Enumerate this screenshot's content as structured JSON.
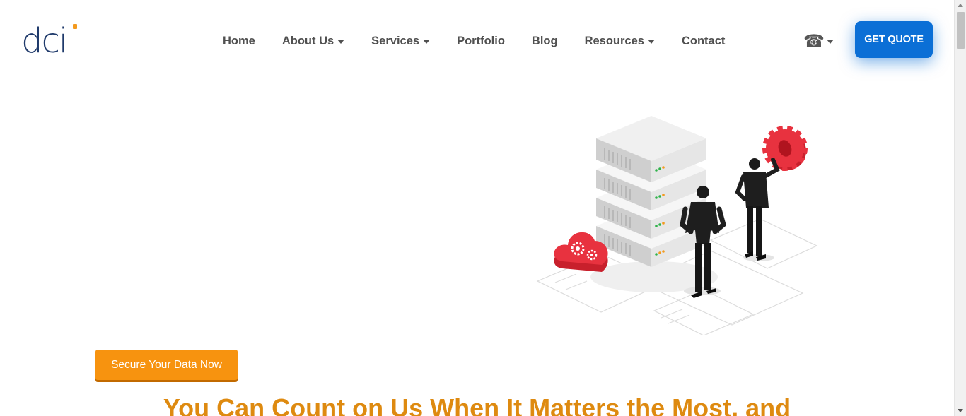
{
  "header": {
    "logo_text": "dci",
    "nav": {
      "home": "Home",
      "about": "About Us",
      "services": "Services",
      "portfolio": "Portfolio",
      "blog": "Blog",
      "resources": "Resources",
      "contact": "Contact"
    },
    "phone_glyph": "☎",
    "quote_button": "GET QUOTE"
  },
  "hero": {
    "cta_button": "Secure Your Data Now",
    "headline": "You Can Count on Us When It Matters the Most, and"
  },
  "colors": {
    "brand_navy": "#1f3a6b",
    "brand_orange": "#f39a1e",
    "quote_blue": "#0b6fd6",
    "cta_orange": "#f7930f",
    "headline_orange": "#de8a10",
    "illustration_red": "#e8323f"
  },
  "icons": {
    "phone": "phone-icon",
    "dropdown": "chevron-down-icon"
  }
}
